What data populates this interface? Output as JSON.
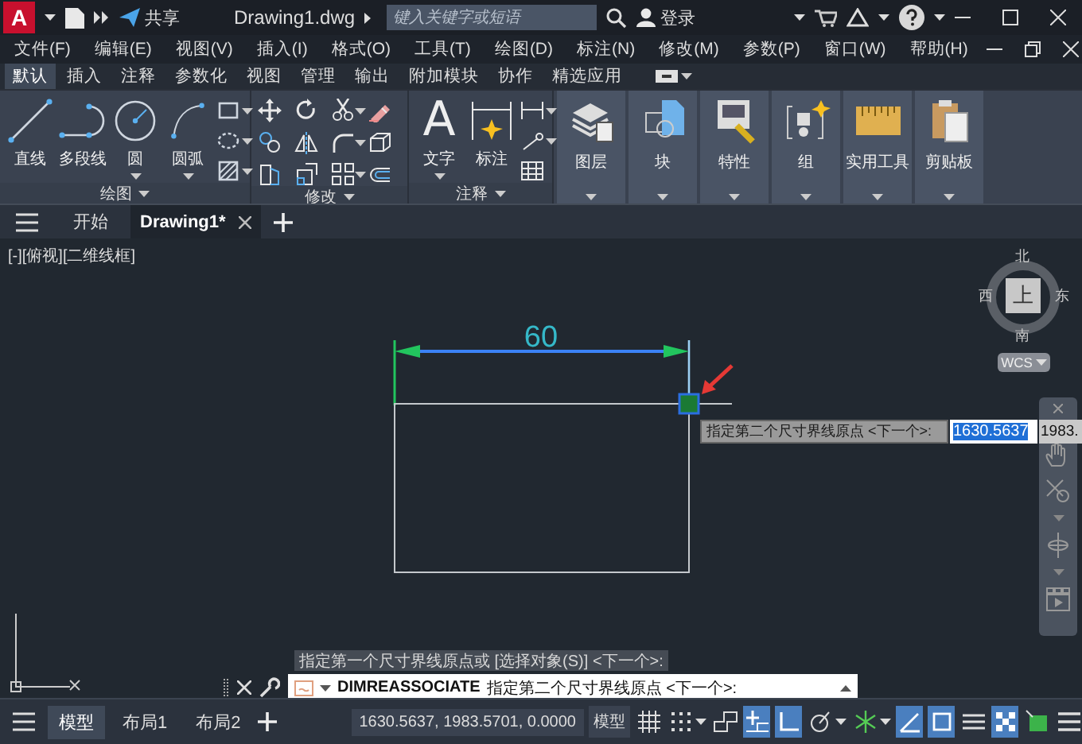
{
  "title_bar": {
    "logo": "A",
    "share": "共享",
    "title": "Drawing1.dwg",
    "search_placeholder": "键入关键字或短语",
    "user": "登录"
  },
  "menu": [
    "文件(F)",
    "编辑(E)",
    "视图(V)",
    "插入(I)",
    "格式(O)",
    "工具(T)",
    "绘图(D)",
    "标注(N)",
    "修改(M)",
    "参数(P)",
    "窗口(W)",
    "帮助(H)"
  ],
  "ribbon_tabs": [
    {
      "label": "默认",
      "selected": true
    },
    {
      "label": "插入",
      "selected": false
    },
    {
      "label": "注释",
      "selected": false
    },
    {
      "label": "参数化",
      "selected": false
    },
    {
      "label": "视图",
      "selected": false
    },
    {
      "label": "管理",
      "selected": false
    },
    {
      "label": "输出",
      "selected": false
    },
    {
      "label": "附加模块",
      "selected": false
    },
    {
      "label": "协作",
      "selected": false
    },
    {
      "label": "精选应用",
      "selected": false
    }
  ],
  "ribbon_panels": [
    {
      "kind": "draw",
      "title": "绘图",
      "tools": [
        {
          "label": "直线",
          "dropdown": false
        },
        {
          "label": "多段线",
          "dropdown": false
        },
        {
          "label": "圆",
          "dropdown": true
        },
        {
          "label": "圆弧",
          "dropdown": true
        }
      ]
    },
    {
      "kind": "modify",
      "title": "修改"
    },
    {
      "kind": "annotate",
      "title": "注释",
      "tools": [
        {
          "label": "文字",
          "icon": "A",
          "dropdown": true
        },
        {
          "label": "标注",
          "dropdown": false
        }
      ]
    },
    {
      "kind": "big",
      "title": "图层"
    },
    {
      "kind": "big",
      "title": "块"
    },
    {
      "kind": "big",
      "title": "特性"
    },
    {
      "kind": "big",
      "title": "组"
    },
    {
      "kind": "big",
      "title": "实用工具"
    },
    {
      "kind": "big",
      "title": "剪贴板"
    }
  ],
  "doc_tabs": [
    {
      "label": "开始",
      "selected": false,
      "closable": false
    },
    {
      "label": "Drawing1*",
      "selected": true,
      "closable": true
    }
  ],
  "viewport": {
    "view_label": "[-][俯视][二维线框]",
    "dimension_text": "60",
    "input_prompt": "指定第二个尺寸界线原点 <下一个>:",
    "x_input": "1630.5637",
    "y_input": "1983.",
    "viewcube": {
      "north": "北",
      "south": "南",
      "east": "东",
      "west": "西",
      "face": "上",
      "ucs_button": "WCS"
    }
  },
  "command_line": {
    "history": "指定第一个尺寸界线原点或 [选择对象(S)] <下一个>:",
    "command": "DIMREASSOCIATE",
    "prompt": "指定第二个尺寸界线原点 <下一个>:"
  },
  "status_bar": {
    "layout_tabs": [
      {
        "label": "模型",
        "selected": true
      },
      {
        "label": "布局1",
        "selected": false
      },
      {
        "label": "布局2",
        "selected": false
      }
    ],
    "coordinates": "1630.5637, 1983.5701, 0.0000",
    "space": "模型",
    "toggles": [
      {
        "kind": "grid",
        "on": false,
        "dropdown": false
      },
      {
        "kind": "snap",
        "on": false,
        "dropdown": true
      },
      {
        "kind": "infer",
        "on": false,
        "dropdown": false
      },
      {
        "kind": "dynamic-input",
        "on": true,
        "dropdown": false
      },
      {
        "kind": "ortho",
        "on": true,
        "dropdown": false
      },
      {
        "kind": "polar",
        "on": false,
        "dropdown": true
      },
      {
        "kind": "isometric",
        "on": false,
        "dropdown": true
      },
      {
        "kind": "osnap-tracking",
        "on": true,
        "dropdown": false
      },
      {
        "kind": "object-snap",
        "on": true,
        "dropdown": false
      },
      {
        "kind": "lineweight",
        "on": false,
        "dropdown": false
      },
      {
        "kind": "transparency",
        "on": true,
        "dropdown": false
      },
      {
        "kind": "selection-cycling",
        "on": false,
        "dropdown": false
      },
      {
        "kind": "customize",
        "on": false,
        "dropdown": false
      }
    ]
  }
}
